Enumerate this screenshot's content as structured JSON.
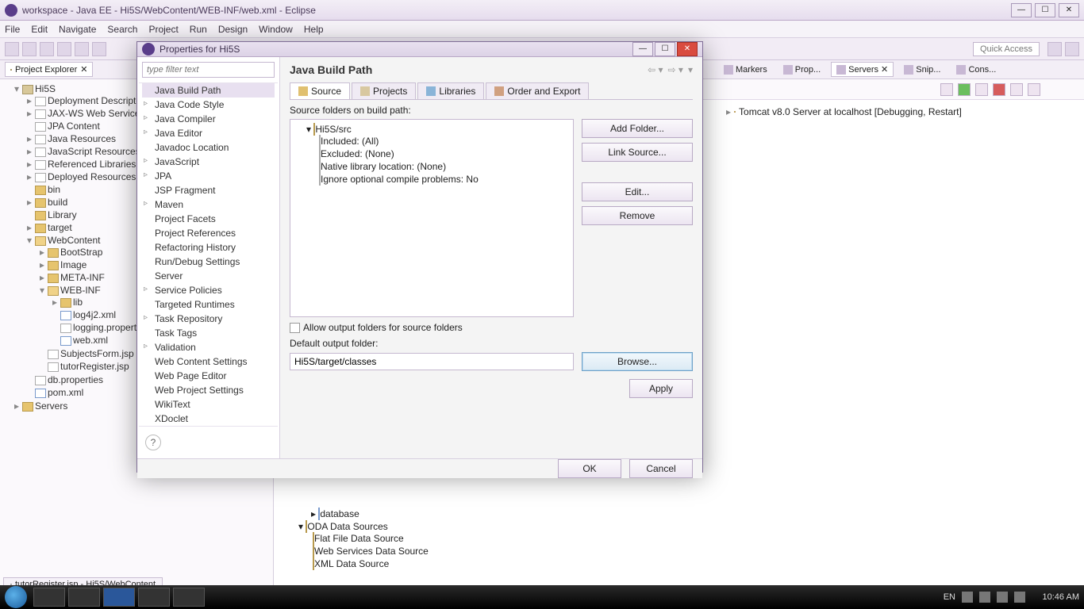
{
  "window": {
    "title": "workspace - Java EE - Hi5S/WebContent/WEB-INF/web.xml - Eclipse",
    "minimize": "—",
    "maximize": "☐",
    "close": "✕"
  },
  "menu": [
    "File",
    "Edit",
    "Navigate",
    "Search",
    "Project",
    "Run",
    "Design",
    "Window",
    "Help"
  ],
  "quick_access": "Quick Access",
  "project_explorer": {
    "title": "Project Explorer",
    "root": "Hi5S",
    "nodes": [
      "Deployment Descriptor",
      "JAX-WS Web Services",
      "JPA Content",
      "Java Resources",
      "JavaScript Resources",
      "Referenced Libraries",
      "Deployed Resources",
      "bin",
      "build",
      "Library",
      "target"
    ],
    "webcontent": "WebContent",
    "wc_children": [
      "BootStrap",
      "Image",
      "META-INF"
    ],
    "webinf": "WEB-INF",
    "webinf_children": [
      "lib",
      "log4j2.xml",
      "logging.properties",
      "web.xml"
    ],
    "after_wc": [
      "SubjectsForm.jsp",
      "tutorRegister.jsp",
      "db.properties",
      "pom.xml"
    ],
    "servers": "Servers"
  },
  "right_tabs": {
    "markers": "Markers",
    "properties": "Prop...",
    "servers": "Servers",
    "snippets": "Snip...",
    "console": "Cons..."
  },
  "server_entry": "Tomcat v8.0 Server at localhost  [Debugging, Restart]",
  "data_tree": {
    "database": "database",
    "oda": "ODA Data Sources",
    "children": [
      "Flat File Data Source",
      "Web Services Data Source",
      "XML Data Source"
    ]
  },
  "bottom_tab": "tutorRegister.jsp - Hi5S/WebContent",
  "dialog": {
    "title": "Properties for Hi5S",
    "filter_placeholder": "type filter text",
    "categories": [
      "Java Build Path",
      "Java Code Style",
      "Java Compiler",
      "Java Editor",
      "Javadoc Location",
      "JavaScript",
      "JPA",
      "JSP Fragment",
      "Maven",
      "Project Facets",
      "Project References",
      "Refactoring History",
      "Run/Debug Settings",
      "Server",
      "Service Policies",
      "Targeted Runtimes",
      "Task Repository",
      "Task Tags",
      "Validation",
      "Web Content Settings",
      "Web Page Editor",
      "Web Project Settings",
      "WikiText",
      "XDoclet"
    ],
    "expandable": [
      1,
      2,
      3,
      5,
      6,
      8,
      14,
      16,
      18
    ],
    "heading": "Java Build Path",
    "tabs": {
      "source": "Source",
      "projects": "Projects",
      "libraries": "Libraries",
      "order": "Order and Export"
    },
    "source_label": "Source folders on build path:",
    "src_root": "Hi5S/src",
    "src_children": [
      "Included: (All)",
      "Excluded: (None)",
      "Native library location: (None)",
      "Ignore optional compile problems: No"
    ],
    "buttons": {
      "add": "Add Folder...",
      "link": "Link Source...",
      "edit": "Edit...",
      "remove": "Remove"
    },
    "allow_output": "Allow output folders for source folders",
    "default_output_label": "Default output folder:",
    "default_output_value": "Hi5S/target/classes",
    "browse": "Browse...",
    "apply": "Apply",
    "ok": "OK",
    "cancel": "Cancel"
  },
  "taskbar": {
    "lang": "EN",
    "time": "10:46 AM"
  }
}
